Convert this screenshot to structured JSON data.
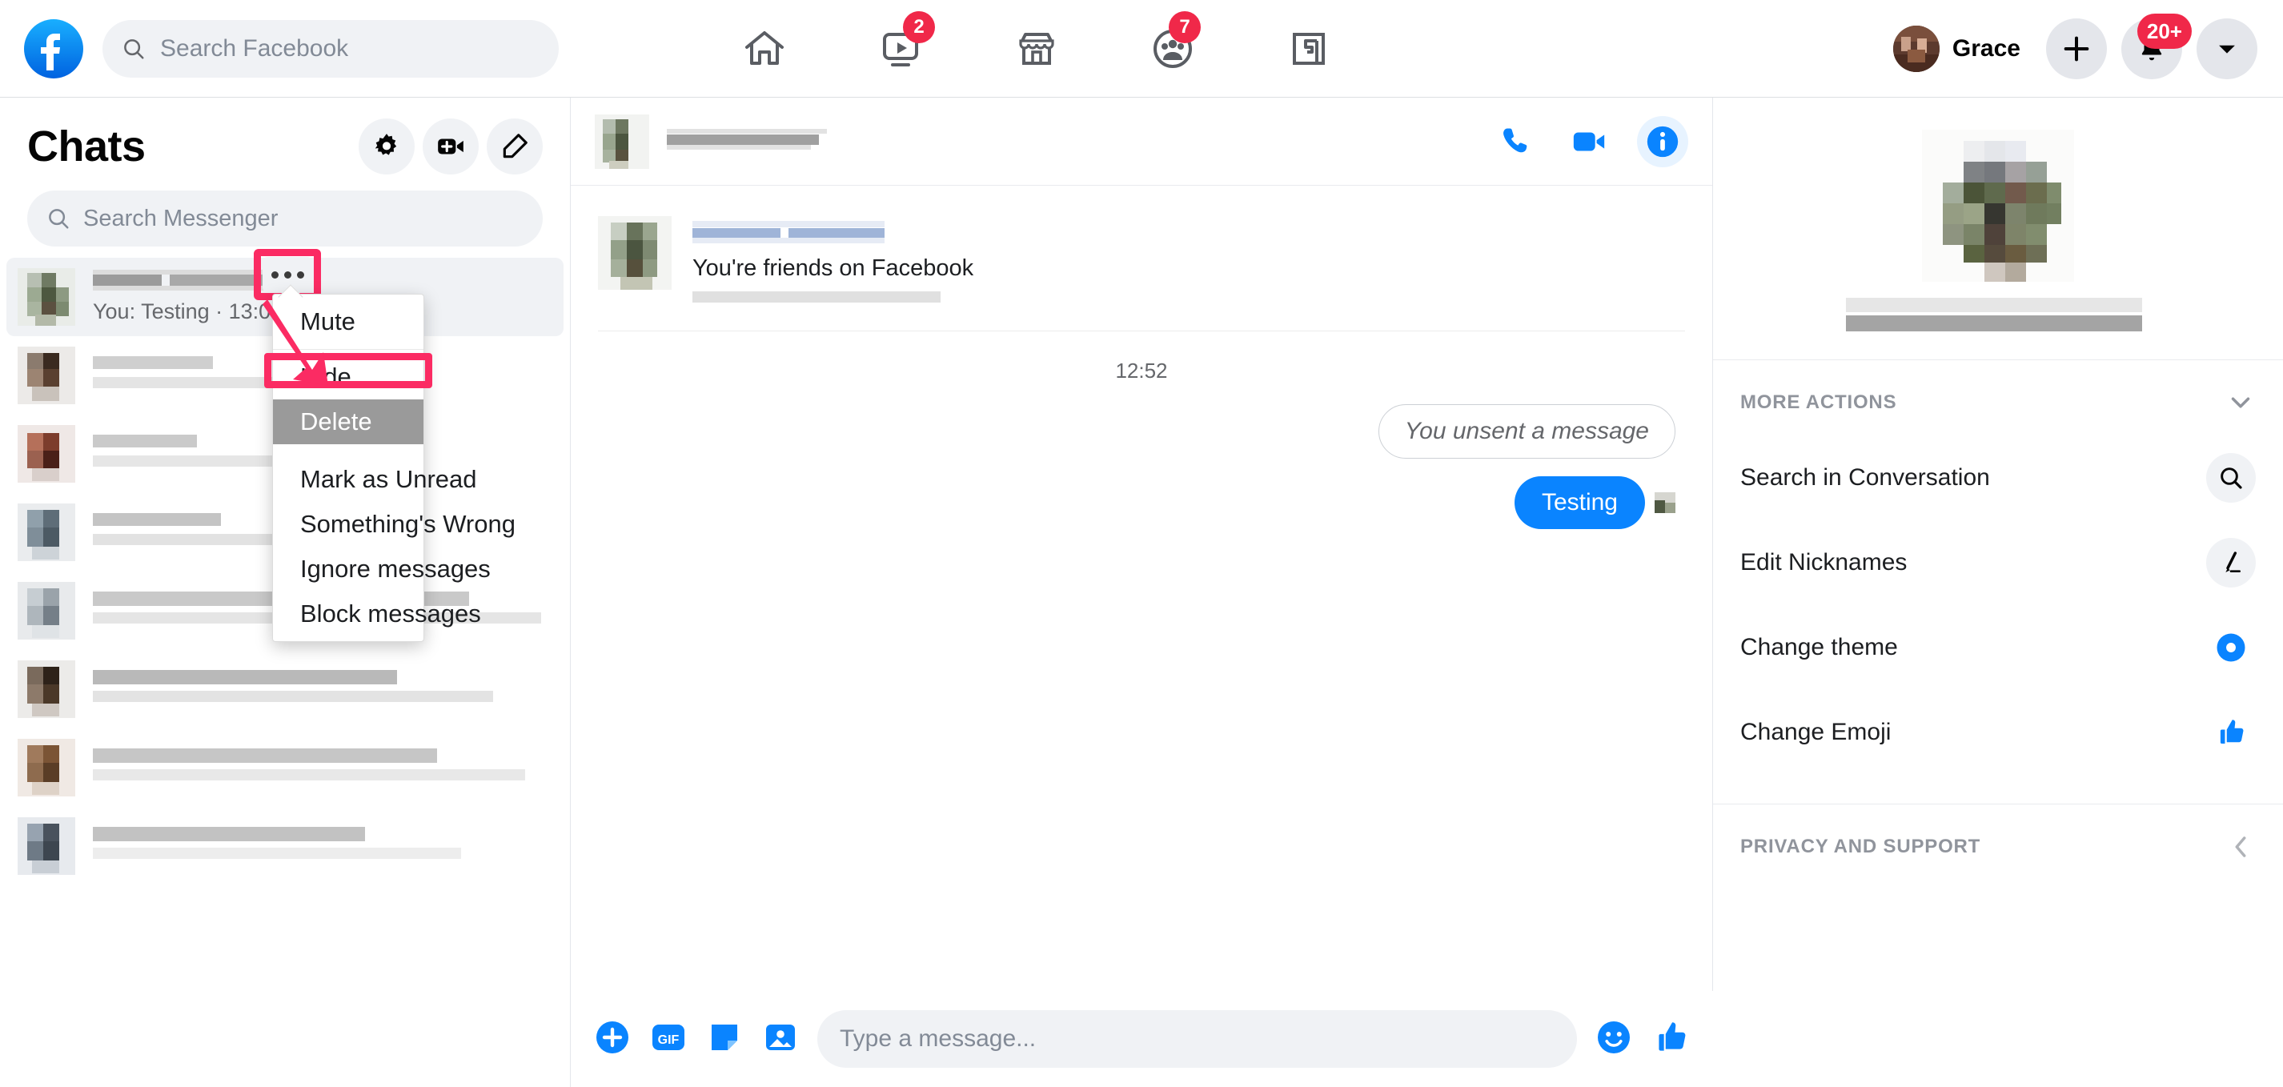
{
  "topbar": {
    "search_placeholder": "Search Facebook",
    "nav_icons": [
      {
        "name": "home-icon",
        "badge": null
      },
      {
        "name": "watch-video-icon",
        "badge": "2"
      },
      {
        "name": "marketplace-icon",
        "badge": null
      },
      {
        "name": "groups-icon",
        "badge": "7"
      },
      {
        "name": "gaming-icon",
        "badge": null
      }
    ],
    "profile_name": "Grace",
    "create_label": "+",
    "notifications_badge": "20+"
  },
  "sidebar": {
    "title": "Chats",
    "search_placeholder": "Search Messenger",
    "active_chat": {
      "preview": "You: Testing · 13:03"
    }
  },
  "context_menu": {
    "items": [
      {
        "label": "Mute",
        "selected": false
      },
      {
        "label": "Hide",
        "selected": false
      },
      {
        "label": "Delete",
        "selected": true
      },
      {
        "label": "Mark as Unread",
        "selected": false
      },
      {
        "label": "Something's Wrong",
        "selected": false
      },
      {
        "label": "Ignore messages",
        "selected": false
      },
      {
        "label": "Block messages",
        "selected": false
      }
    ],
    "highlight_color": "#fb2b63",
    "selected_bg": "#9a9a9a"
  },
  "chat": {
    "intro_subtitle": "You're friends on Facebook",
    "timestamp": "12:52",
    "messages": [
      {
        "type": "unsent",
        "text": "You unsent a message"
      },
      {
        "type": "sent",
        "text": "Testing"
      }
    ],
    "composer_placeholder": "Type a message..."
  },
  "right_panel": {
    "more_actions_title": "MORE ACTIONS",
    "actions": [
      {
        "label": "Search in Conversation",
        "icon": "search-icon"
      },
      {
        "label": "Edit Nicknames",
        "icon": "pencil-icon"
      },
      {
        "label": "Change theme",
        "icon": "color-circle-icon"
      },
      {
        "label": "Change Emoji",
        "icon": "thumbs-up-icon"
      }
    ],
    "privacy_title": "PRIVACY AND SUPPORT"
  },
  "colors": {
    "fb_blue": "#0a84ff",
    "accent_pink": "#fb2b63",
    "badge_red": "#f02849"
  }
}
